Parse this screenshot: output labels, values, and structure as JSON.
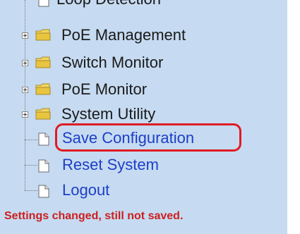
{
  "tree": {
    "top_item": {
      "label": "Loop Detection",
      "icon": "document-icon"
    },
    "folders": [
      {
        "label": "PoE Management",
        "icon": "folder-icon",
        "expander": "plus"
      },
      {
        "label": "Switch Monitor",
        "icon": "folder-icon",
        "expander": "plus"
      },
      {
        "label": "PoE Monitor",
        "icon": "folder-icon",
        "expander": "plus"
      },
      {
        "label": "System Utility",
        "icon": "folder-icon",
        "expander": "plus"
      }
    ],
    "links": [
      {
        "label": "Save Configuration",
        "icon": "document-icon",
        "highlighted": true
      },
      {
        "label": "Reset System",
        "icon": "document-icon"
      },
      {
        "label": "Logout",
        "icon": "document-icon"
      }
    ]
  },
  "status_message": "Settings changed, still not saved.",
  "colors": {
    "background": "#c6dbf1",
    "link": "#1c3fc8",
    "highlight": "#e01b24",
    "status": "#cc1f1f",
    "folder": "#e8c440"
  }
}
